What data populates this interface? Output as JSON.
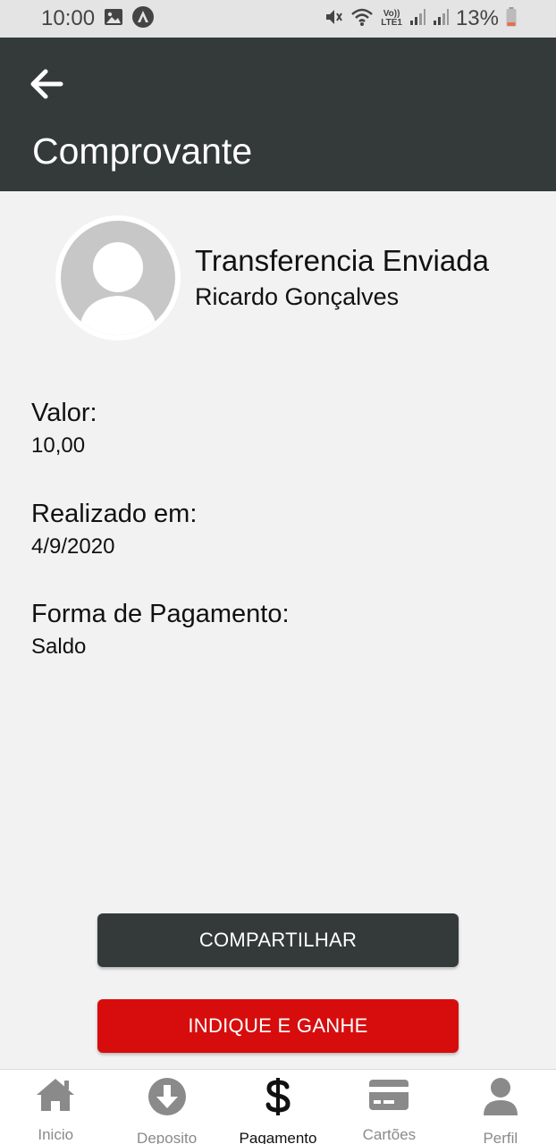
{
  "status_bar": {
    "time": "10:00",
    "battery_percent": "13%",
    "network": "LTE1",
    "network_top": "Vo))",
    "icons": [
      "image-icon",
      "app-notification-icon",
      "mute-icon",
      "wifi-icon",
      "signal-icon",
      "signal-icon",
      "battery-icon"
    ]
  },
  "app_bar": {
    "back_icon": "arrow-left-icon",
    "title": "Comprovante"
  },
  "transaction": {
    "title": "Transferencia Enviada",
    "recipient": "Ricardo Gonçalves",
    "avatar_icon": "user-placeholder-icon"
  },
  "details": [
    {
      "label": "Valor:",
      "value": "10,00"
    },
    {
      "label": "Realizado em:",
      "value": "4/9/2020"
    },
    {
      "label": "Forma de Pagamento:",
      "value": "Saldo"
    }
  ],
  "actions": {
    "share_label": "COMPARTILHAR",
    "invite_label": "INDIQUE E GANHE"
  },
  "bottom_nav": {
    "active": "Pagamento",
    "items": [
      {
        "label": "Inicio",
        "icon": "home-icon"
      },
      {
        "label": "Deposito",
        "icon": "download-circle-icon"
      },
      {
        "label": "Pagamento",
        "icon": "dollar-icon"
      },
      {
        "label": "Cartões",
        "icon": "credit-card-icon"
      },
      {
        "label": "Perfil",
        "icon": "person-icon"
      }
    ]
  },
  "colors": {
    "app_bar": "#343a3a",
    "background": "#f2f2f2",
    "share_button": "#343a3a",
    "invite_button": "#d70d0d",
    "nav_inactive": "#8a8a8a"
  }
}
